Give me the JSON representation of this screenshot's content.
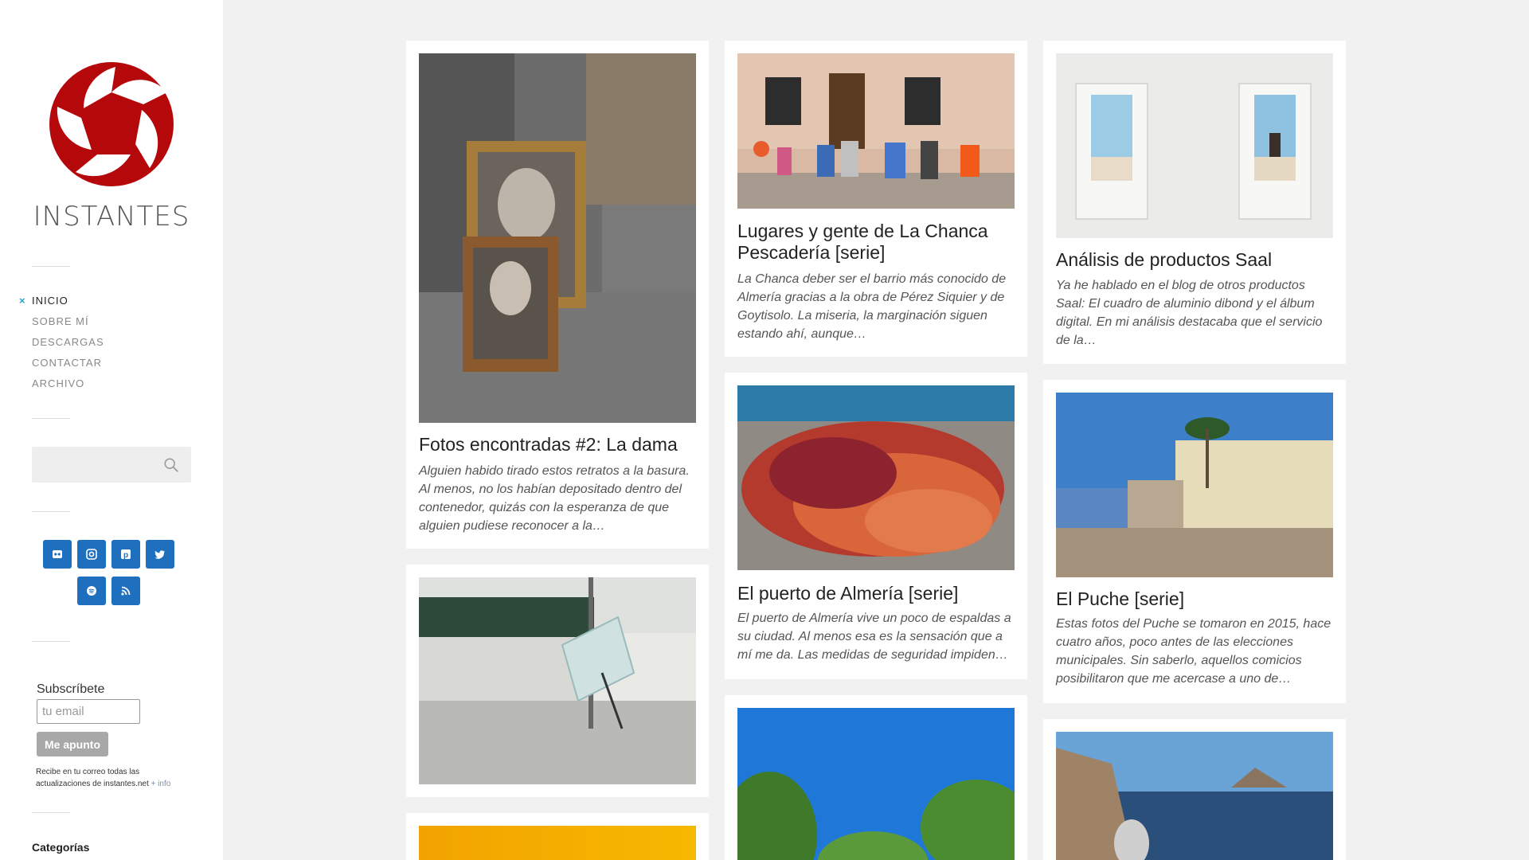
{
  "site": {
    "title": "INSTANTES",
    "brand_color": "#b5080b"
  },
  "nav": {
    "items": [
      {
        "label": "INICIO",
        "active": true
      },
      {
        "label": "SOBRE MÍ",
        "active": false
      },
      {
        "label": "DESCARGAS",
        "active": false
      },
      {
        "label": "CONTACTAR",
        "active": false
      },
      {
        "label": "ARCHIVO",
        "active": false
      }
    ],
    "active_marker": "×"
  },
  "search": {
    "placeholder": ""
  },
  "social": {
    "color": "#1f6fbf",
    "icons": [
      "flickr-icon",
      "instagram-icon",
      "pinterest-icon",
      "twitter-icon",
      "spotify-icon",
      "rss-icon"
    ]
  },
  "subscribe": {
    "label": "Subscríbete",
    "email_placeholder": "tu email",
    "button_label": "Me apunto",
    "note": "Recibe en tu correo todas las actualizaciones de instantes.net",
    "more_link": "+ info"
  },
  "categories": {
    "title": "Categorías"
  },
  "posts": [
    {
      "title": "Fotos encontradas #2: La dama",
      "excerpt": "Alguien habido tirado estos retratos a la basura. Al menos, no los habían depositado dentro del contenedor, quizás con la esperanza de que alguien pudiese reconocer a la…"
    },
    {
      "title": "Lugares y gente de La Chanca Pescadería [serie]",
      "excerpt": "La Chanca deber ser el barrio más conocido de Almería gracias a la obra de Pérez Siquier y de Goytisolo. La miseria, la marginación siguen estando ahí, aunque…"
    },
    {
      "title": "Análisis de productos Saal",
      "excerpt": "Ya he hablado en el blog de otros productos Saal: El cuadro de aluminio dibond y el álbum digital. En mi análisis destacaba que el servicio de la…"
    },
    {
      "title": "El puerto de Almería [serie]",
      "excerpt": "El puerto de Almería vive un poco de espaldas a su ciudad. Al menos esa es la sensación que a mí me da. Las medidas de seguridad impiden…"
    },
    {
      "title": "El Puche [serie]",
      "excerpt": "Estas fotos del Puche se tomaron en 2015, hace cuatro años, poco antes de las elecciones municipales. Sin saberlo, aquellos comicios posibilitaron que me acercase a uno de…"
    }
  ]
}
